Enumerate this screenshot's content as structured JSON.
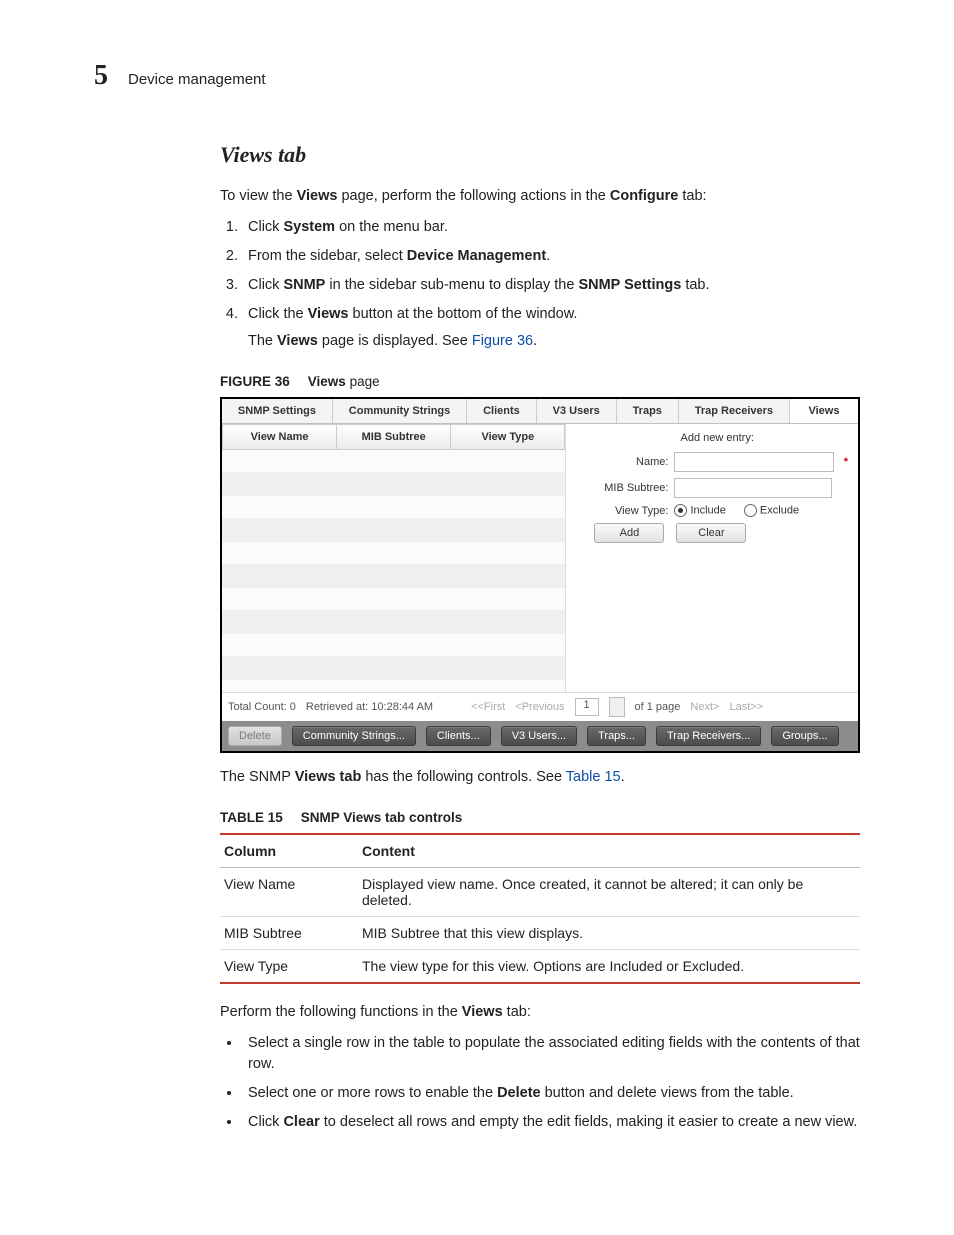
{
  "header": {
    "chapter_num": "5",
    "chapter_title": "Device management"
  },
  "section_title": "Views tab",
  "intro": {
    "pre": "To view the ",
    "b1": "Views",
    "mid": " page, perform the following actions in the ",
    "b2": "Configure",
    "post": " tab:"
  },
  "steps": {
    "s1_a": "Click ",
    "s1_b": "System",
    "s1_c": " on the menu bar.",
    "s2_a": "From the sidebar, select ",
    "s2_b": "Device Management",
    "s2_c": ".",
    "s3_a": "Click ",
    "s3_b": "SNMP",
    "s3_c": " in the sidebar sub-menu to display the ",
    "s3_d": "SNMP Settings",
    "s3_e": " tab.",
    "s4_a": "Click the ",
    "s4_b": "Views",
    "s4_c": " button at the bottom of the window.",
    "s4_sub_a": "The ",
    "s4_sub_b": "Views",
    "s4_sub_c": " page is displayed. See ",
    "s4_sub_link": "Figure 36",
    "s4_sub_d": "."
  },
  "figure_caption": {
    "label": "FIGURE 36",
    "b": "Views",
    "rest": " page"
  },
  "shot": {
    "tabs": [
      "SNMP Settings",
      "Community Strings",
      "Clients",
      "V3 Users",
      "Traps",
      "Trap Receivers",
      "Views"
    ],
    "grid_headers": [
      "View Name",
      "MIB Subtree",
      "View Type"
    ],
    "form": {
      "title": "Add new entry:",
      "name_label": "Name:",
      "mib_label": "MIB Subtree:",
      "type_label": "View Type:",
      "opt_include": "Include",
      "opt_exclude": "Exclude",
      "btn_add": "Add",
      "btn_clear": "Clear",
      "req": "*"
    },
    "pager": {
      "total": "Total Count: 0",
      "retrieved": "Retrieved at: 10:28:44 AM",
      "first": "<<First",
      "prev": "<Previous",
      "page_val": "1",
      "of": "of 1 page",
      "next": "Next>",
      "last": "Last>>"
    },
    "footer": [
      "Delete",
      "Community Strings...",
      "Clients...",
      "V3 Users...",
      "Traps...",
      "Trap Receivers...",
      "Groups..."
    ]
  },
  "after_fig": {
    "a": "The SNMP ",
    "b": "Views tab",
    "c": " has the following controls. See ",
    "link": "Table 15",
    "d": "."
  },
  "table_caption": {
    "label": "TABLE 15",
    "title": "SNMP Views tab controls"
  },
  "table15": {
    "head": [
      "Column",
      "Content"
    ],
    "rows": [
      [
        "View Name",
        "Displayed view name. Once created, it cannot be altered; it can only be deleted."
      ],
      [
        "MIB Subtree",
        "MIB Subtree that this view displays."
      ],
      [
        "View Type",
        "The view type for this view. Options are Included or Excluded."
      ]
    ]
  },
  "perform": {
    "a": "Perform the following functions in the ",
    "b": "Views",
    "c": " tab:"
  },
  "bullets": {
    "b1": "Select a single row in the table to populate the associated editing fields with the contents of that row.",
    "b2_a": "Select one or more rows to enable the ",
    "b2_b": "Delete",
    "b2_c": " button and delete views from the table.",
    "b3_a": "Click ",
    "b3_b": "Clear",
    "b3_c": " to deselect all rows and empty the edit fields, making it easier to create a new view."
  }
}
